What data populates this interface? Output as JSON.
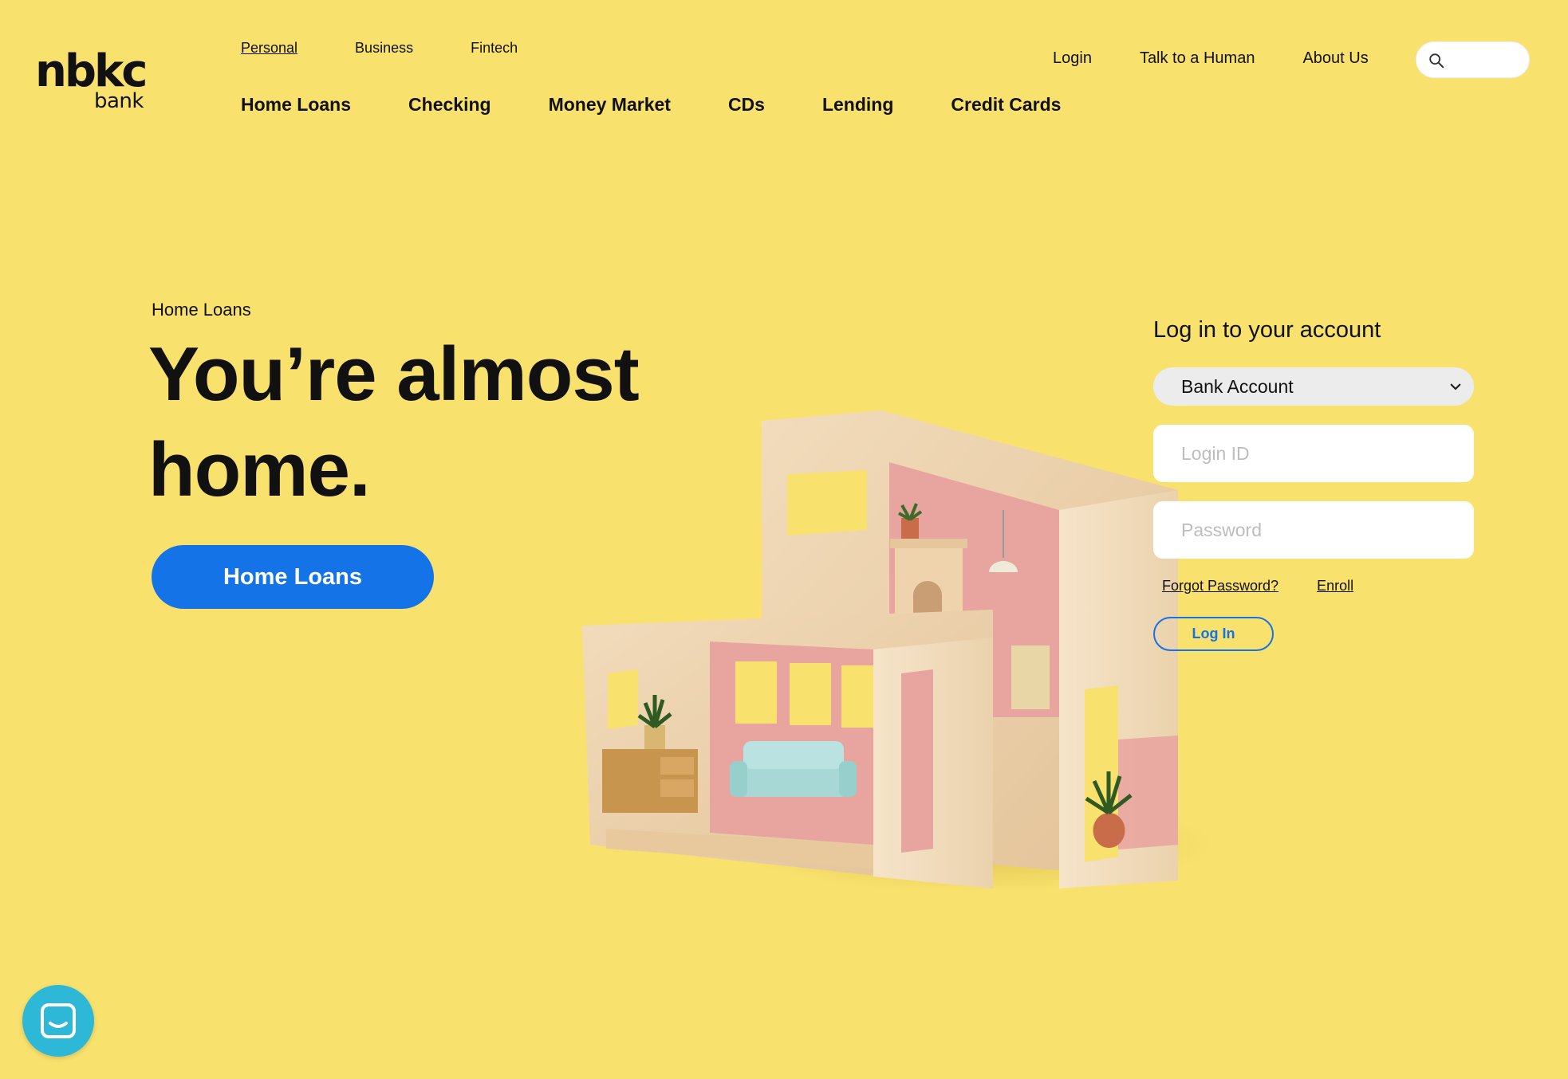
{
  "brand": {
    "name": "nbkc",
    "sub": "bank"
  },
  "segment_nav": [
    {
      "label": "Personal",
      "active": true
    },
    {
      "label": "Business"
    },
    {
      "label": "Fintech"
    }
  ],
  "utility_nav": [
    {
      "label": "Login"
    },
    {
      "label": "Talk to a Human"
    },
    {
      "label": "About Us"
    }
  ],
  "search": {
    "icon": "search-icon",
    "value": ""
  },
  "main_nav": [
    {
      "label": "Home Loans"
    },
    {
      "label": "Checking"
    },
    {
      "label": "Money Market"
    },
    {
      "label": "CDs"
    },
    {
      "label": "Lending"
    },
    {
      "label": "Credit Cards"
    }
  ],
  "hero": {
    "eyebrow": "Home Loans",
    "title": "You’re almost home.",
    "cta_label": "Home Loans"
  },
  "login": {
    "title": "Log in to your account",
    "account_type": "Bank Account",
    "login_id_placeholder": "Login ID",
    "password_placeholder": "Password",
    "forgot_label": "Forgot Password?",
    "enroll_label": "Enroll",
    "button_label": "Log In"
  },
  "chat": {
    "icon": "chat-icon"
  },
  "colors": {
    "background": "#f8e16c",
    "accent": "#1473e6",
    "chat": "#2eb8d8"
  }
}
